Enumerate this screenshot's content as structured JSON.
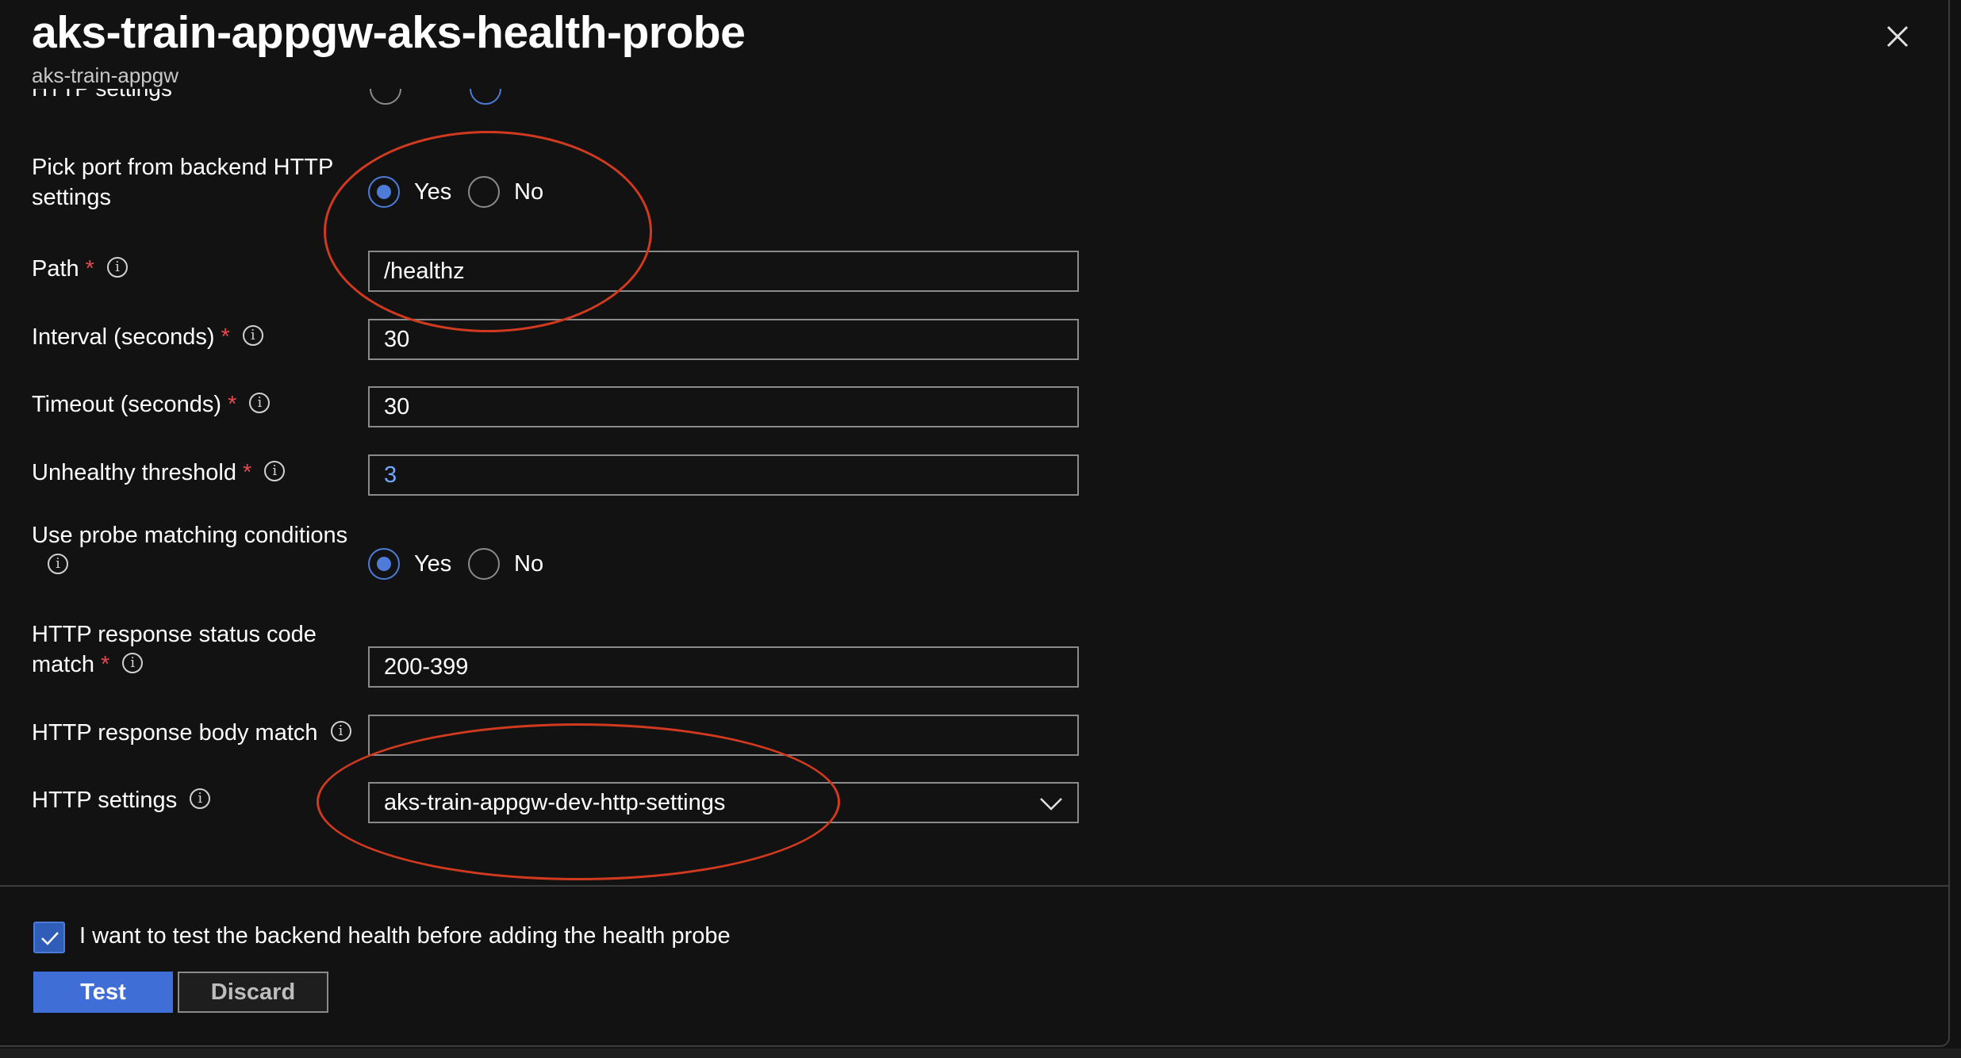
{
  "header": {
    "title": "aks-train-appgw-aks-health-probe",
    "subtitle": "aks-train-appgw"
  },
  "partial_row": {
    "label": "HTTP settings"
  },
  "form": {
    "pick_port": {
      "label": "Pick port from backend HTTP settings",
      "yes": "Yes",
      "no": "No",
      "selected": "Yes"
    },
    "path": {
      "label": "Path",
      "value": "/healthz"
    },
    "interval": {
      "label": "Interval (seconds)",
      "value": "30"
    },
    "timeout": {
      "label": "Timeout (seconds)",
      "value": "30"
    },
    "unhealthy": {
      "label": "Unhealthy threshold",
      "value": "3"
    },
    "use_probe": {
      "label": "Use probe matching conditions",
      "yes": "Yes",
      "no": "No",
      "selected": "Yes"
    },
    "status_code": {
      "label_line1": "HTTP response status code",
      "label_line2": "match",
      "value": "200-399"
    },
    "body_match": {
      "label": "HTTP response body match",
      "value": ""
    },
    "http_settings": {
      "label": "HTTP settings",
      "value": "aks-train-appgw-dev-http-settings"
    }
  },
  "footer": {
    "checkbox_label": "I want to test the backend health before adding the health probe",
    "checked": true,
    "test_label": "Test",
    "discard_label": "Discard"
  },
  "colors": {
    "background": "#121212",
    "accent": "#4f7bd8",
    "required": "#e5484d",
    "annotation": "#d23a1f"
  }
}
